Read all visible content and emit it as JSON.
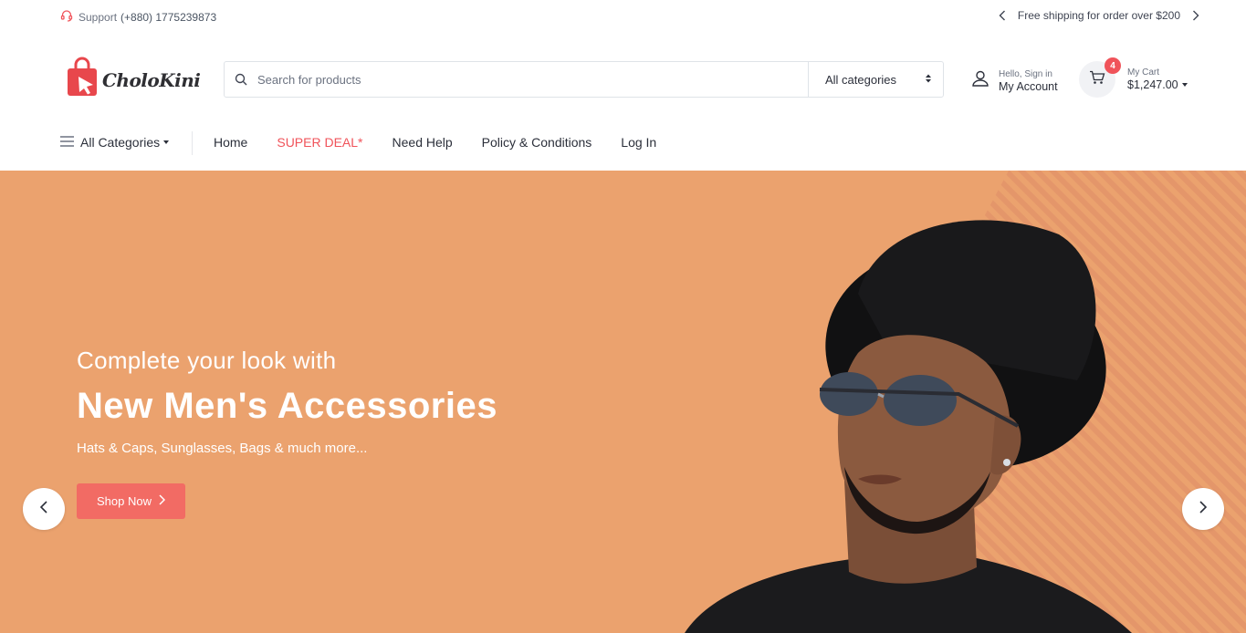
{
  "topbar": {
    "support_label": "Support",
    "support_phone": "(+880) 1775239873",
    "shipping_text": "Free shipping for order over $200"
  },
  "header": {
    "logo_text": "CholoKini",
    "search_placeholder": "Search for products",
    "category_select": "All categories",
    "account_small": "Hello, Sign in",
    "account_big": "My Account",
    "cart_small": "My Cart",
    "cart_total": "$1,247.00",
    "cart_count": "4"
  },
  "nav": {
    "all_categories": "All Categories",
    "links": [
      "Home",
      "SUPER DEAL*",
      "Need Help",
      "Policy & Conditions",
      "Log In"
    ]
  },
  "hero": {
    "subtitle": "Complete your look with",
    "title": "New Men's Accessories",
    "description": "Hats & Caps, Sunglasses, Bags & much more...",
    "button": "Shop Now"
  },
  "colors": {
    "accent": "#f0535a",
    "hero_bg": "#eba26e",
    "button": "#f26b64"
  },
  "icons": {
    "support": "headset-icon",
    "search": "search-icon",
    "account": "user-icon",
    "cart": "cart-icon",
    "menu": "hamburger-icon"
  }
}
